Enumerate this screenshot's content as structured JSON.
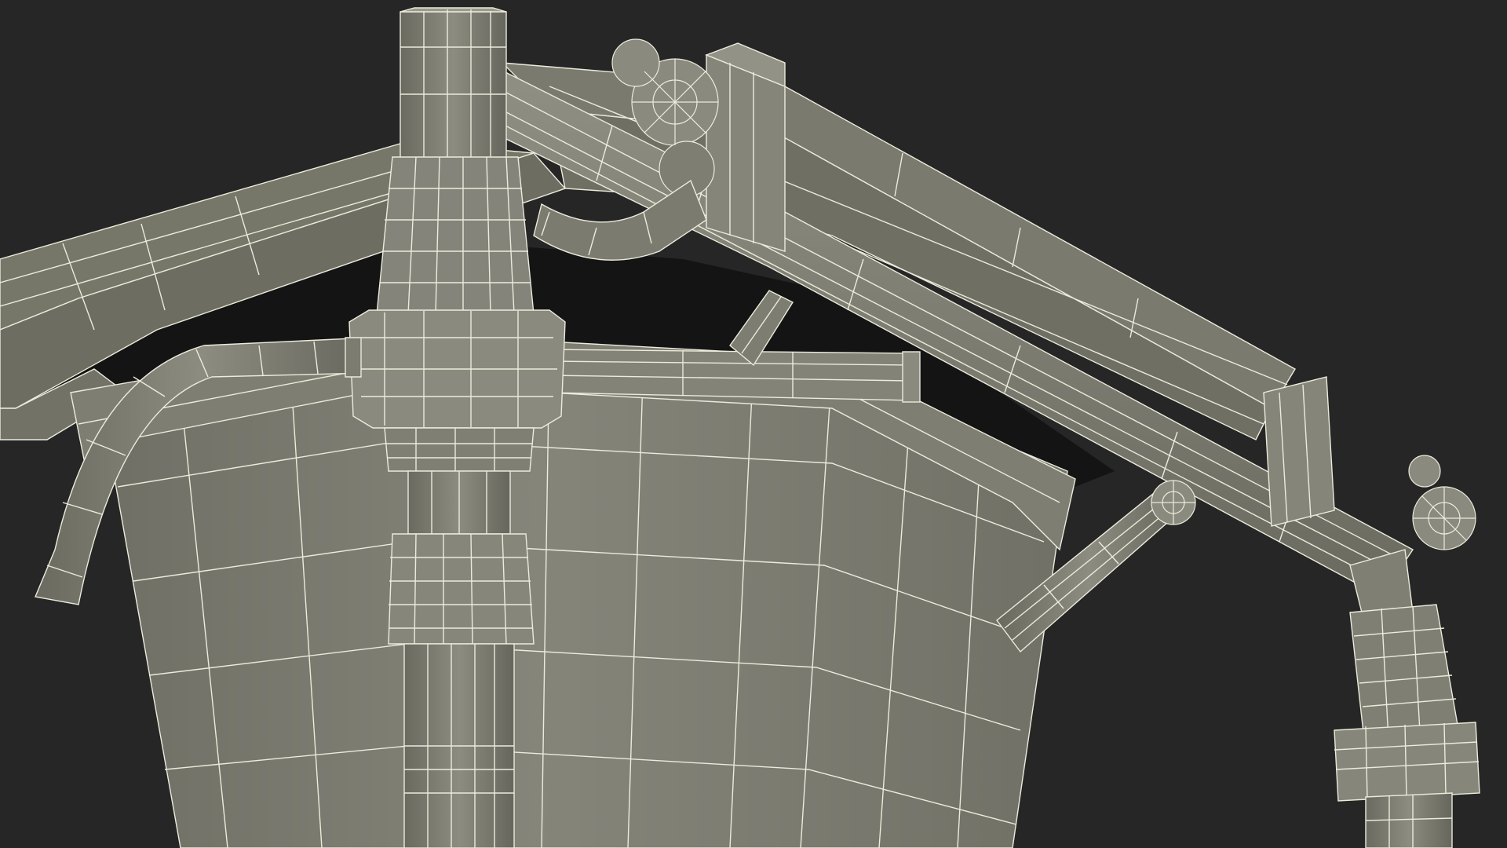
{
  "scene": {
    "description_hidden": false,
    "colors": {
      "background": "#262626",
      "surface": "#7d7d72",
      "surface_dark": "#5f5f56",
      "surface_light": "#8d8d82",
      "wire": "#ecebdc",
      "cavity": "#141414"
    },
    "render_mode": "wireframe-on-shaded"
  }
}
